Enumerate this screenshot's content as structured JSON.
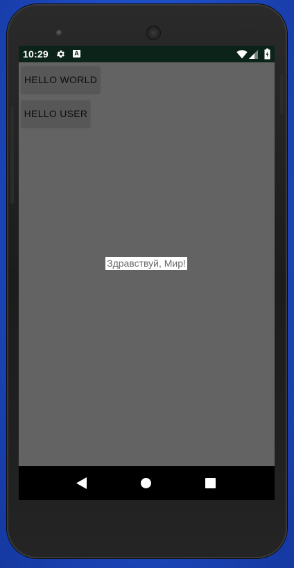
{
  "status_bar": {
    "time": "10:29",
    "notification_icons": [
      "gear-icon",
      "a-icon"
    ],
    "notification_a_glyph": "A",
    "system_icons": [
      "wifi-icon",
      "signal-icon",
      "battery-icon"
    ],
    "background": "#0b2319"
  },
  "app": {
    "background": "#636363",
    "buttons": [
      {
        "label": "HELLO WORLD"
      },
      {
        "label": "HELLO USER"
      }
    ],
    "center_text": "Здравствуй, Мир!"
  },
  "nav_bar": {
    "icons": [
      "back-icon",
      "home-icon",
      "recents-icon"
    ]
  },
  "colors": {
    "desktop_background": "#2050c8",
    "button_background": "#575757",
    "text_highlight_background": "#ffffff",
    "text_color": "#6a6a6a"
  }
}
